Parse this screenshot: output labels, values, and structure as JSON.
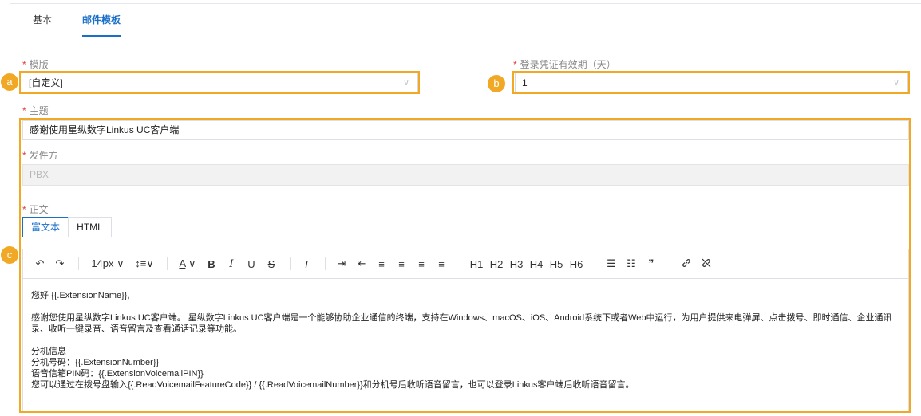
{
  "tabs": [
    {
      "label": "基本"
    },
    {
      "label": "邮件模板"
    }
  ],
  "template": {
    "label": "模版",
    "value": "[自定义]"
  },
  "validity": {
    "label": "登录凭证有效期（天）",
    "value": "1"
  },
  "subject": {
    "label": "主题",
    "value": "感谢使用星纵数字Linkus UC客户端"
  },
  "sender": {
    "label": "发件方",
    "value": "PBX"
  },
  "body": {
    "label": "正文",
    "modes": [
      "富文本",
      "HTML"
    ]
  },
  "toolbar": {
    "undo": "↶",
    "redo": "↷",
    "font_size": "14px",
    "line_height": "↕≡",
    "font_color": "A",
    "bold": "B",
    "italic": "I",
    "underline": "U",
    "strike": "S",
    "clear": "T",
    "indent": "⇥",
    "outdent": "⇤",
    "align_left": "≡",
    "align_center": "≡",
    "align_right": "≡",
    "justify": "≡",
    "h1": "H1",
    "h2": "H2",
    "h3": "H3",
    "h4": "H4",
    "h5": "H5",
    "h6": "H6",
    "bullet": "☰",
    "numbered": "☷",
    "quote": "❞",
    "link": "🔗",
    "unlink": "⛓",
    "hr": "—"
  },
  "badges": {
    "a": "a",
    "b": "b",
    "c": "c"
  },
  "content": {
    "line1": "您好 {{.ExtensionName}},",
    "line2": "感谢您使用星纵数字Linkus UC客户端。 星纵数字Linkus UC客户端是一个能够协助企业通信的终端，支持在Windows、macOS、iOS、Android系统下或者Web中运行，为用户提供来电弹屏、点击拨号、即时通信、企业通讯录、收听一键录音、语音留言及查看通话记录等功能。",
    "line3": "分机信息",
    "line4": "分机号码：{{.ExtensionNumber}}",
    "line5": "语音信箱PIN码：{{.ExtensionVoicemailPIN}}",
    "line6": "您可以通过在拨号盘输入{{.ReadVoicemailFeatureCode}} / {{.ReadVoicemailNumber}}和分机号后收听语音留言，也可以登录Linkus客户端后收听语音留言。"
  }
}
